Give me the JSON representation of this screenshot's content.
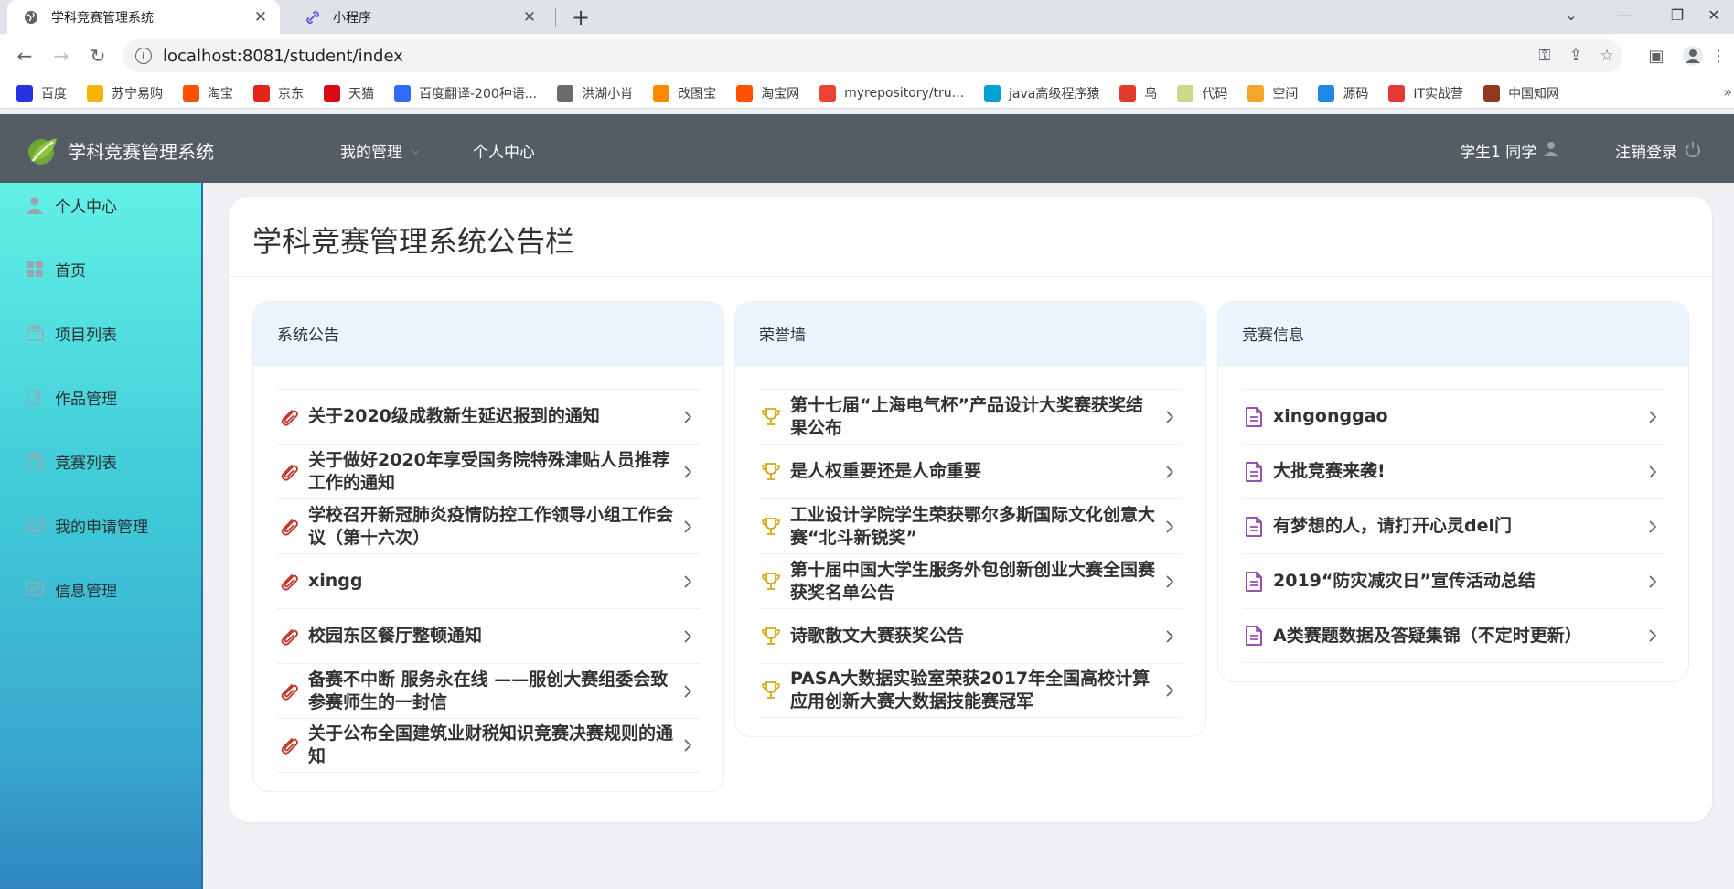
{
  "browser": {
    "tabs": [
      {
        "title": "学科竞赛管理系统",
        "active": true
      },
      {
        "title": "小程序",
        "active": false
      }
    ],
    "url": "localhost:8081/student/index",
    "bookmarks": [
      {
        "label": "百度",
        "color": "#2932e1"
      },
      {
        "label": "苏宁易购",
        "color": "#f7b500"
      },
      {
        "label": "淘宝",
        "color": "#ff5000"
      },
      {
        "label": "京东",
        "color": "#e1251b"
      },
      {
        "label": "天猫",
        "color": "#d70b16"
      },
      {
        "label": "百度翻译-200种语...",
        "color": "#2f6bff"
      },
      {
        "label": "洪湖小肖",
        "color": "#6b6b6b"
      },
      {
        "label": "改图宝",
        "color": "#ff8a00"
      },
      {
        "label": "淘宝网",
        "color": "#ff5000"
      },
      {
        "label": "myrepository/tru...",
        "color": "#ea4335"
      },
      {
        "label": "java高级程序猿",
        "color": "#00a1d6"
      },
      {
        "label": "鸟",
        "color": "#e33a2e"
      },
      {
        "label": "代码",
        "color": "#c9d88a"
      },
      {
        "label": "空间",
        "color": "#f3a62b"
      },
      {
        "label": "源码",
        "color": "#1e88e5"
      },
      {
        "label": "IT实战营",
        "color": "#e53935"
      },
      {
        "label": "中国知网",
        "color": "#8d3a1f"
      }
    ]
  },
  "header": {
    "app_title": "学科竞赛管理系统",
    "nav": [
      {
        "label": "我的管理",
        "has_caret": true
      },
      {
        "label": "个人中心",
        "has_caret": false
      }
    ],
    "user_label": "学生1 同学",
    "logout_label": "注销登录"
  },
  "sidebar": {
    "items": [
      {
        "label": "个人中心",
        "icon": "user-icon"
      },
      {
        "label": "首页",
        "icon": "grid-icon"
      },
      {
        "label": "项目列表",
        "icon": "stack-icon"
      },
      {
        "label": "作品管理",
        "icon": "edit-icon"
      },
      {
        "label": "竞赛列表",
        "icon": "stack-icon"
      },
      {
        "label": "我的申请管理",
        "icon": "card-icon"
      },
      {
        "label": "信息管理",
        "icon": "chart-icon"
      }
    ]
  },
  "main": {
    "title": "学科竞赛管理系统公告栏",
    "panels": [
      {
        "title": "系统公告",
        "icon": "paperclip-icon",
        "icon_color": "#c0392b",
        "items": [
          "关于2020级成教新生延迟报到的通知",
          "关于做好2020年享受国务院特殊津贴人员推荐工作的通知",
          "学校召开新冠肺炎疫情防控工作领导小组工作会议（第十六次）",
          "xingg",
          "校园东区餐厅整顿通知",
          "备赛不中断 服务永在线 ——服创大赛组委会致参赛师生的一封信",
          "关于公布全国建筑业财税知识竞赛决赛规则的通知"
        ]
      },
      {
        "title": "荣誉墙",
        "icon": "trophy-icon",
        "icon_color": "#d4a90c",
        "items": [
          "第十七届“上海电气杯”产品设计大奖赛获奖结果公布",
          "是人权重要还是人命重要",
          "工业设计学院学生荣获鄂尔多斯国际文化创意大赛“北斗新锐奖”",
          "第十届中国大学生服务外包创新创业大赛全国赛获奖名单公告",
          "诗歌散文大赛获奖公告",
          "PASA大数据实验室荣获2017年全国高校计算应用创新大赛大数据技能赛冠军"
        ]
      },
      {
        "title": "竞赛信息",
        "icon": "document-icon",
        "icon_color": "#8e3aa8",
        "items": [
          "xingonggao",
          "大批竞赛来袭!",
          "有梦想的人，请打开心灵del门",
          "2019“防灾减灾日”宣传活动总结",
          "A类赛题数据及答疑集锦（不定时更新）"
        ]
      }
    ]
  }
}
